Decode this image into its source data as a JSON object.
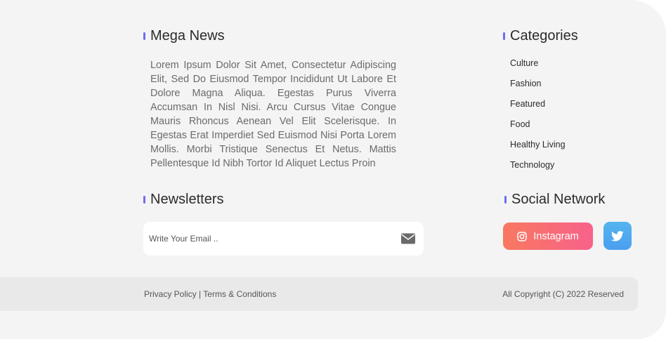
{
  "about": {
    "title": "Mega News",
    "text": "Lorem Ipsum Dolor Sit Amet, Consectetur Adipiscing Elit, Sed Do Eiusmod Tempor Incididunt Ut Labore Et Dolore Magna Aliqua. Egestas Purus Viverra Accumsan In Nisl Nisi. Arcu Cursus Vitae Congue Mauris Rhoncus Aenean Vel Elit Scelerisque. In Egestas Erat Imperdiet Sed Euismod Nisi Porta Lorem Mollis. Morbi Tristique Senectus Et Netus. Mattis Pellentesque Id Nibh Tortor Id Aliquet Lectus Proin"
  },
  "newsletter": {
    "title": "Newsletters",
    "placeholder": "Write Your Email ..",
    "icon": "mail-icon"
  },
  "categories": {
    "title": "Categories",
    "items": [
      "Culture",
      "Fashion",
      "Featured",
      "Food",
      "Healthy Living",
      "Technology"
    ]
  },
  "social": {
    "title": "Social Network",
    "instagram_label": "Instagram",
    "instagram_icon": "instagram-icon",
    "twitter_icon": "twitter-icon"
  },
  "bottom": {
    "privacy": "Privacy Policy",
    "separator": "|",
    "terms": "Terms & Conditions",
    "copyright": "All Copyright (C) 2022 Reserved"
  },
  "colors": {
    "accent": "#6d6ef0",
    "background": "#f4f4f4",
    "bottom_bar": "#e9e9e9",
    "instagram_start": "#f97860",
    "instagram_end": "#f7628b",
    "twitter": "#54b4ee"
  }
}
